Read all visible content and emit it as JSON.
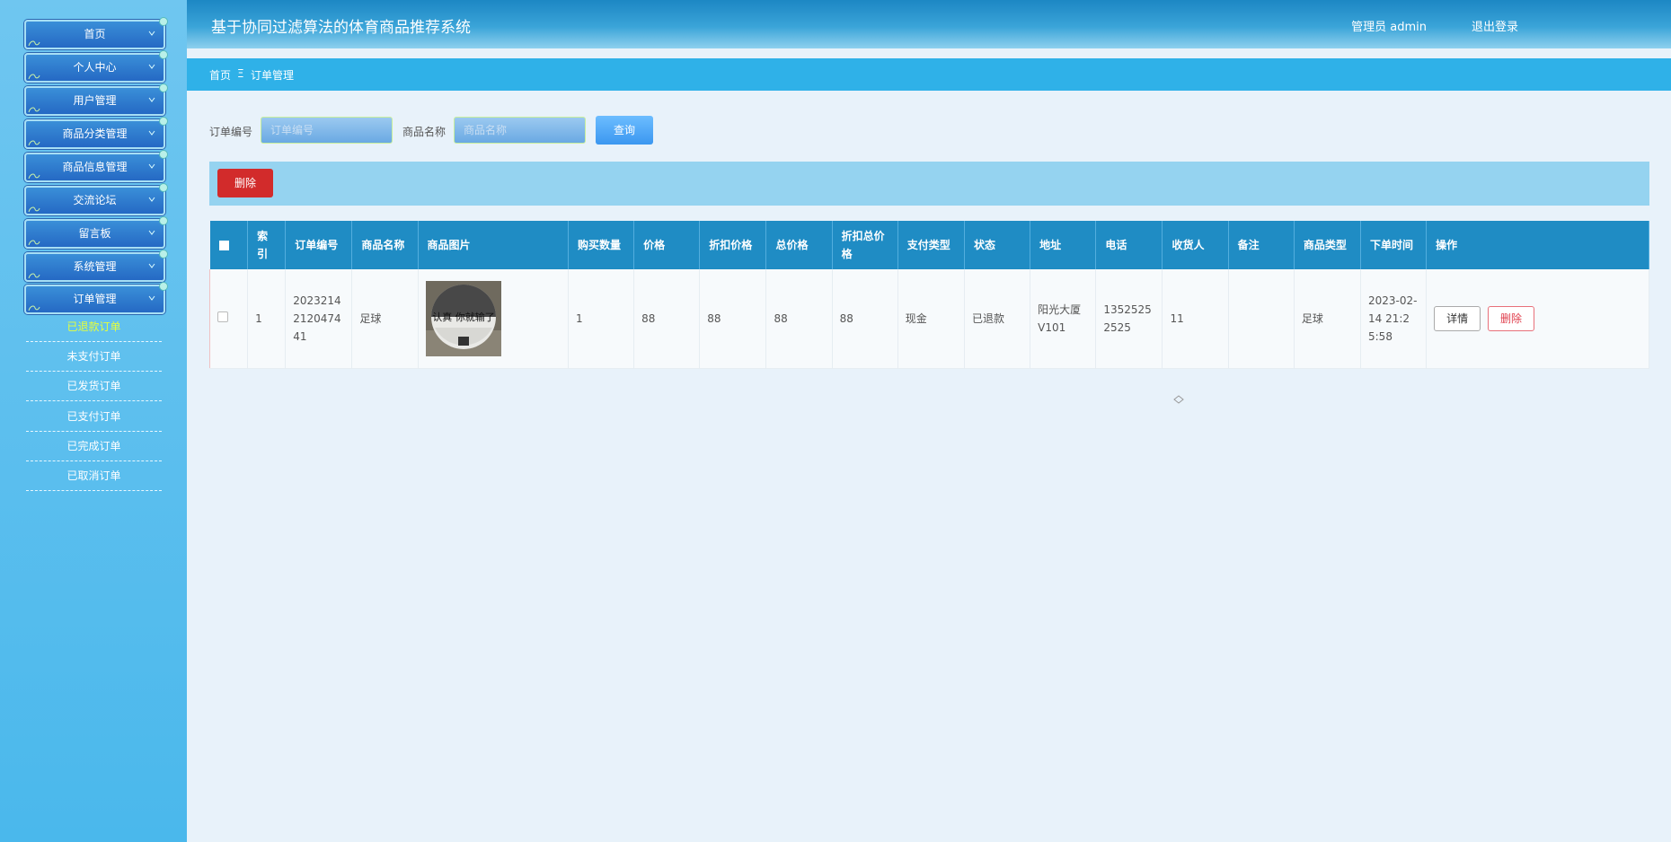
{
  "header": {
    "title": "基于协同过滤算法的体育商品推荐系统",
    "admin": "管理员 admin",
    "logout": "退出登录"
  },
  "sidebar": {
    "menu": [
      {
        "label": "首页"
      },
      {
        "label": "个人中心"
      },
      {
        "label": "用户管理"
      },
      {
        "label": "商品分类管理"
      },
      {
        "label": "商品信息管理"
      },
      {
        "label": "交流论坛"
      },
      {
        "label": "留言板"
      },
      {
        "label": "系统管理"
      },
      {
        "label": "订单管理"
      }
    ],
    "submenu": [
      {
        "label": "已退款订单",
        "active": true
      },
      {
        "label": "未支付订单"
      },
      {
        "label": "已发货订单"
      },
      {
        "label": "已支付订单"
      },
      {
        "label": "已完成订单"
      },
      {
        "label": "已取消订单"
      }
    ]
  },
  "breadcrumb": {
    "home": "首页",
    "sep": "Ξ",
    "current": "订单管理"
  },
  "search": {
    "order_label": "订单编号",
    "order_placeholder": "订单编号",
    "product_label": "商品名称",
    "product_placeholder": "商品名称",
    "query_button": "查询"
  },
  "toolbar": {
    "delete_button": "删除"
  },
  "table": {
    "headers": [
      "索引",
      "订单编号",
      "商品名称",
      "商品图片",
      "购买数量",
      "价格",
      "折扣价格",
      "总价格",
      "折扣总价格",
      "支付类型",
      "状态",
      "地址",
      "电话",
      "收货人",
      "备注",
      "商品类型",
      "下单时间",
      "操作"
    ],
    "rows": [
      {
        "index": "1",
        "order_no": "2023214212047441",
        "product": "足球",
        "qty": "1",
        "price": "88",
        "discount_price": "88",
        "total": "88",
        "discount_total": "88",
        "pay_type": "现金",
        "status": "已退款",
        "address": "阳光大厦V101",
        "phone": "13525252525",
        "receiver": "11",
        "remark": "",
        "category": "足球",
        "time": "2023-02-14 21:25:58",
        "detail_btn": "详情",
        "delete_btn": "删除",
        "image_text": "认真 你就输了"
      }
    ]
  }
}
